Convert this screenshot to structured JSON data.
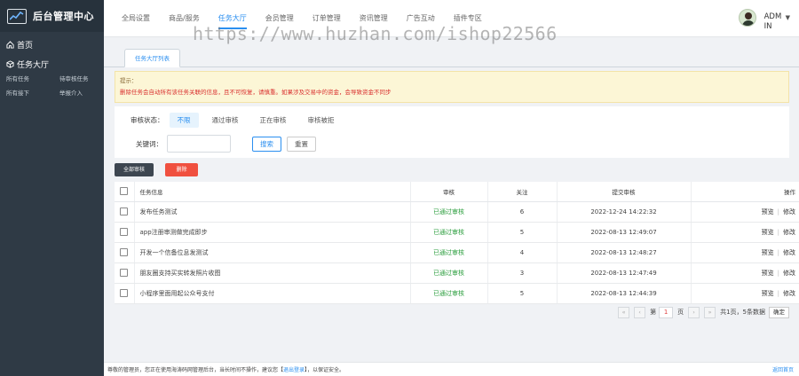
{
  "sidebar": {
    "title": "后台管理中心",
    "home": "首页",
    "group": "任务大厅",
    "items": [
      "所有任务",
      "待审核任务",
      "所有接下",
      "举报介入"
    ]
  },
  "topnav": {
    "items": [
      "全局设置",
      "商品/服务",
      "任务大厅",
      "会员管理",
      "订单管理",
      "资讯管理",
      "广告互动",
      "插件专区"
    ],
    "active_index": 2,
    "user": "ADMIN"
  },
  "watermark": "https://www.huzhan.com/ishop22566",
  "tab": "任务大厅列表",
  "notice": {
    "title": "提示：",
    "text": "删除任务会自动所有该任务关联的信息，且不可恢复，请慎重。如果涉及交易中的资金，会导致资金不同步"
  },
  "filter": {
    "status_label": "审核状态：",
    "options": [
      "不限",
      "通过审核",
      "正在审核",
      "审核被拒"
    ],
    "keyword_label": "关键词：",
    "keyword_value": "",
    "search": "搜索",
    "reset": "重置"
  },
  "actions": {
    "batch": "全部审核",
    "delete": "删除"
  },
  "table": {
    "headers": [
      "任务信息",
      "审核",
      "关注",
      "提交审核",
      "操作"
    ],
    "rows": [
      {
        "title": "发布任务测试",
        "status": "已通过审核",
        "count": "6",
        "time": "2022-12-24 14:22:32",
        "op1": "预览",
        "op2": "修改"
      },
      {
        "title": "app注册审测做完成即步",
        "status": "已通过审核",
        "count": "5",
        "time": "2022-08-13 12:49:07",
        "op1": "预览",
        "op2": "修改"
      },
      {
        "title": "开发一个信备位息发测试",
        "status": "已通过审核",
        "count": "4",
        "time": "2022-08-13 12:48:27",
        "op1": "预览",
        "op2": "修改"
      },
      {
        "title": "朋友圈支持买实转发照片收图",
        "status": "已通过审核",
        "count": "3",
        "time": "2022-08-13 12:47:49",
        "op1": "预览",
        "op2": "修改"
      },
      {
        "title": "小程序里面用起公众号支付",
        "status": "已通过审核",
        "count": "5",
        "time": "2022-08-13 12:44:39",
        "op1": "预览",
        "op2": "修改"
      }
    ]
  },
  "pager": {
    "first": "«",
    "prev": "‹",
    "page_prefix": "第",
    "current": "1",
    "page_suffix": "页",
    "next": "›",
    "last": "»",
    "summary": "共1页，5条数据",
    "go": "确定"
  },
  "footer": {
    "text_before": "尊敬的管理员，您正在使用海涛码网管理后台，当长时间不操作，建议您【",
    "link": "退出登录",
    "text_after": "】，以保证安全。",
    "right": "返回首页"
  },
  "colors": {
    "sidebar_bg": "#2f3a45",
    "accent": "#2b8ff0",
    "danger": "#f0503f",
    "success": "#2a9d3c"
  }
}
